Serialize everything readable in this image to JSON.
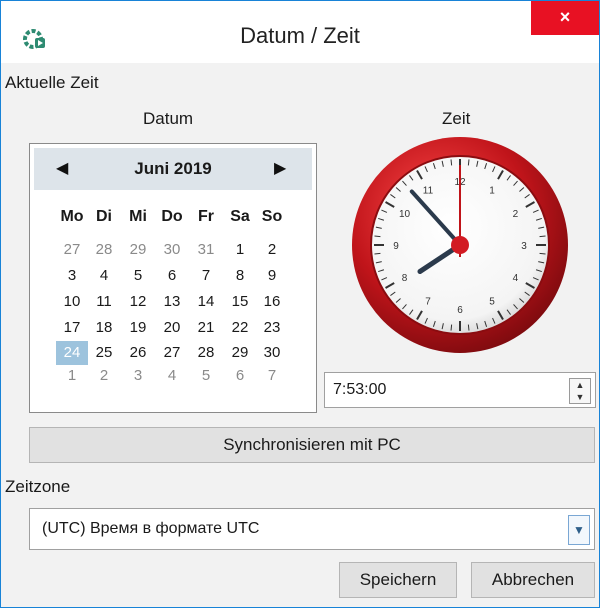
{
  "window": {
    "title": "Datum / Zeit",
    "close_glyph": "×",
    "icon": "app-settings-icon"
  },
  "current_time_label": "Aktuelle Zeit",
  "date_label": "Datum",
  "time_label": "Zeit",
  "calendar": {
    "month": "Juni 2019",
    "weekdays": [
      "Mo",
      "Di",
      "Mi",
      "Do",
      "Fr",
      "Sa",
      "So"
    ],
    "days": [
      [
        "27",
        "28",
        "29",
        "30",
        "31",
        "1",
        "2"
      ],
      [
        "3",
        "4",
        "5",
        "6",
        "7",
        "8",
        "9"
      ],
      [
        "10",
        "11",
        "12",
        "13",
        "14",
        "15",
        "16"
      ],
      [
        "17",
        "18",
        "19",
        "20",
        "21",
        "22",
        "23"
      ],
      [
        "24",
        "25",
        "26",
        "27",
        "28",
        "29",
        "30"
      ],
      [
        "1",
        "2",
        "3",
        "4",
        "5",
        "6",
        "7"
      ]
    ],
    "today": "24"
  },
  "clock": {
    "hour": 7,
    "minute": 53,
    "second": 0,
    "numbers": [
      "12",
      "1",
      "2",
      "3",
      "4",
      "5",
      "6",
      "7",
      "8",
      "9",
      "10",
      "11"
    ],
    "rim_color": "#c0141a"
  },
  "time_value": "7:53:00",
  "sync_button": "Synchronisieren mit PC",
  "timezone_label": "Zeitzone",
  "timezone_value": "(UTC) Время в формате UTC",
  "save_button": "Speichern",
  "cancel_button": "Abbrechen"
}
